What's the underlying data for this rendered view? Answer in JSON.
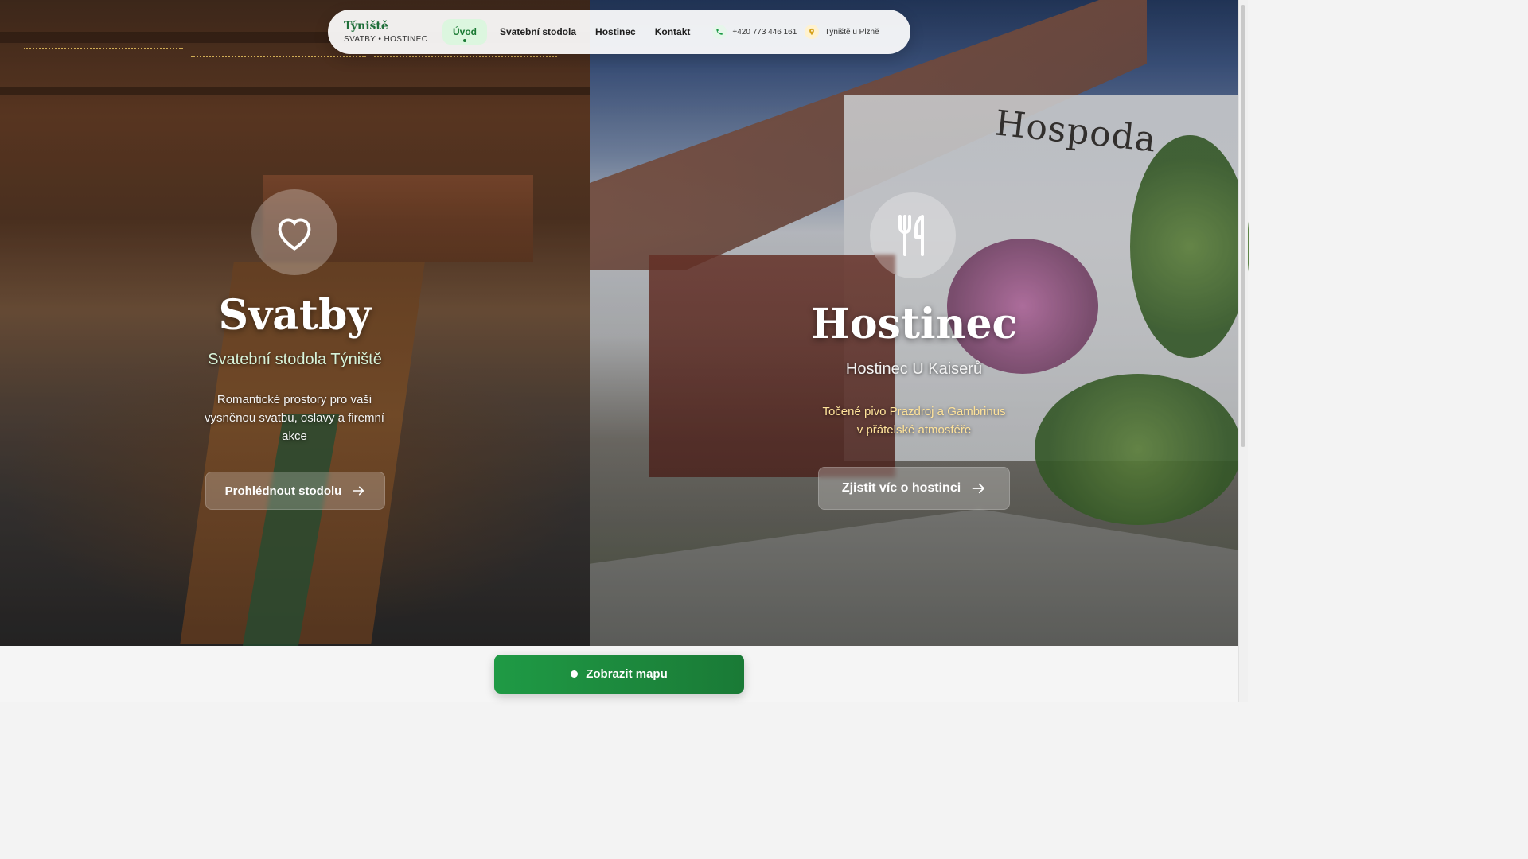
{
  "nav": {
    "brand_name": "Týniště",
    "brand_sub": "SVATBY • HOSTINEC",
    "items": [
      {
        "label": "Úvod",
        "active": true
      },
      {
        "label": "Svatební stodola",
        "active": false
      },
      {
        "label": "Hostinec",
        "active": false
      },
      {
        "label": "Kontakt",
        "active": false
      }
    ],
    "phone": "+420 773 446 161",
    "location": "Týniště u Plzně",
    "accent": "#1b7a34"
  },
  "left": {
    "icon": "heart-icon",
    "title": "Svatby",
    "subtitle": "Svatební stodola Týniště",
    "description_lines": [
      "Romantické prostory pro vaši",
      "vysněnou svatbu, oslavy a firemní",
      "akce"
    ],
    "button": "Prohlédnout stodolu"
  },
  "right": {
    "icon": "fork-knife-icon",
    "title": "Hostinec",
    "subtitle": "Hostinec U Kaiserů",
    "description_lines": [
      "Točené pivo Prazdroj a Gambrinus",
      "v přátelské atmosféře"
    ],
    "button": "Zjistit víc o hostinci",
    "sign_text": "Hospoda"
  },
  "map_button": "Zobrazit mapu"
}
